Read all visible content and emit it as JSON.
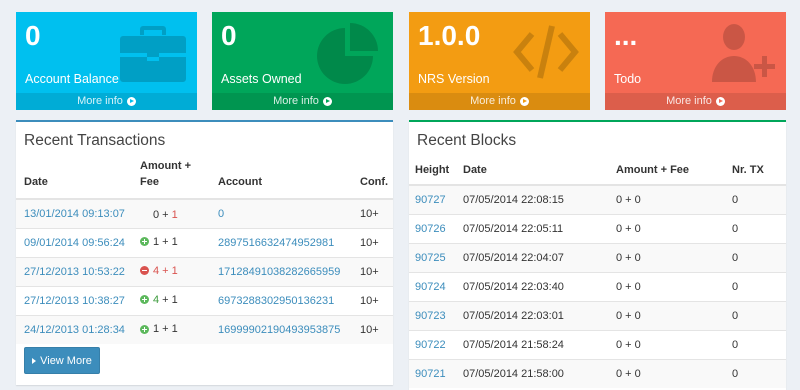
{
  "tiles": {
    "balance": {
      "value": "0",
      "label": "Account Balance",
      "more": "More info",
      "color": "#00c0ef",
      "icon": "briefcase-icon"
    },
    "assets": {
      "value": "0",
      "label": "Assets Owned",
      "more": "More info",
      "color": "#00a65a",
      "icon": "pie-chart-icon"
    },
    "version": {
      "value": "1.0.0",
      "label": "NRS Version",
      "more": "More info",
      "color": "#f39c12",
      "icon": "code-icon"
    },
    "todo": {
      "value": "...",
      "label": "Todo",
      "more": "More info",
      "color": "#f56954",
      "icon": "add-user-icon"
    }
  },
  "transactions": {
    "title": "Recent Transactions",
    "columns": {
      "date": "Date",
      "amount_line1": "Amount +",
      "amount_line2": "Fee",
      "account": "Account",
      "conf": "Conf."
    },
    "rows": [
      {
        "date": "13/01/2014 09:13:07",
        "icon": "none",
        "amount": "0",
        "sep": " + ",
        "fee": "1",
        "account": "0",
        "conf": "10+"
      },
      {
        "date": "09/01/2014 09:56:24",
        "icon": "plus",
        "amount": "1",
        "sep": " + ",
        "fee": "1",
        "account": "2897516632474952981",
        "conf": "10+"
      },
      {
        "date": "27/12/2013 10:53:22",
        "icon": "minus",
        "amount": "4",
        "sep": " + ",
        "fee": "1",
        "account": "17128491038282665959",
        "conf": "10+"
      },
      {
        "date": "27/12/2013 10:38:27",
        "icon": "plus",
        "amount": "4",
        "sep": " + ",
        "fee": "1",
        "account": "6973288302950136231",
        "conf": "10+"
      },
      {
        "date": "24/12/2013 01:28:34",
        "icon": "plus",
        "amount": "1",
        "sep": " + ",
        "fee": "1",
        "account": "16999902190493953875",
        "conf": "10+"
      }
    ],
    "view_more": "View More"
  },
  "blocks": {
    "title": "Recent Blocks",
    "columns": {
      "height": "Height",
      "date": "Date",
      "amount": "Amount + Fee",
      "ntx": "Nr. TX"
    },
    "rows": [
      {
        "height": "90727",
        "date": "07/05/2014 22:08:15",
        "amount": "0 + 0",
        "ntx": "0"
      },
      {
        "height": "90726",
        "date": "07/05/2014 22:05:11",
        "amount": "0 + 0",
        "ntx": "0"
      },
      {
        "height": "90725",
        "date": "07/05/2014 22:04:07",
        "amount": "0 + 0",
        "ntx": "0"
      },
      {
        "height": "90724",
        "date": "07/05/2014 22:03:40",
        "amount": "0 + 0",
        "ntx": "0"
      },
      {
        "height": "90723",
        "date": "07/05/2014 22:03:01",
        "amount": "0 + 0",
        "ntx": "0"
      },
      {
        "height": "90722",
        "date": "07/05/2014 21:58:24",
        "amount": "0 + 0",
        "ntx": "0"
      },
      {
        "height": "90721",
        "date": "07/05/2014 21:58:00",
        "amount": "0 + 0",
        "ntx": "0"
      }
    ]
  }
}
